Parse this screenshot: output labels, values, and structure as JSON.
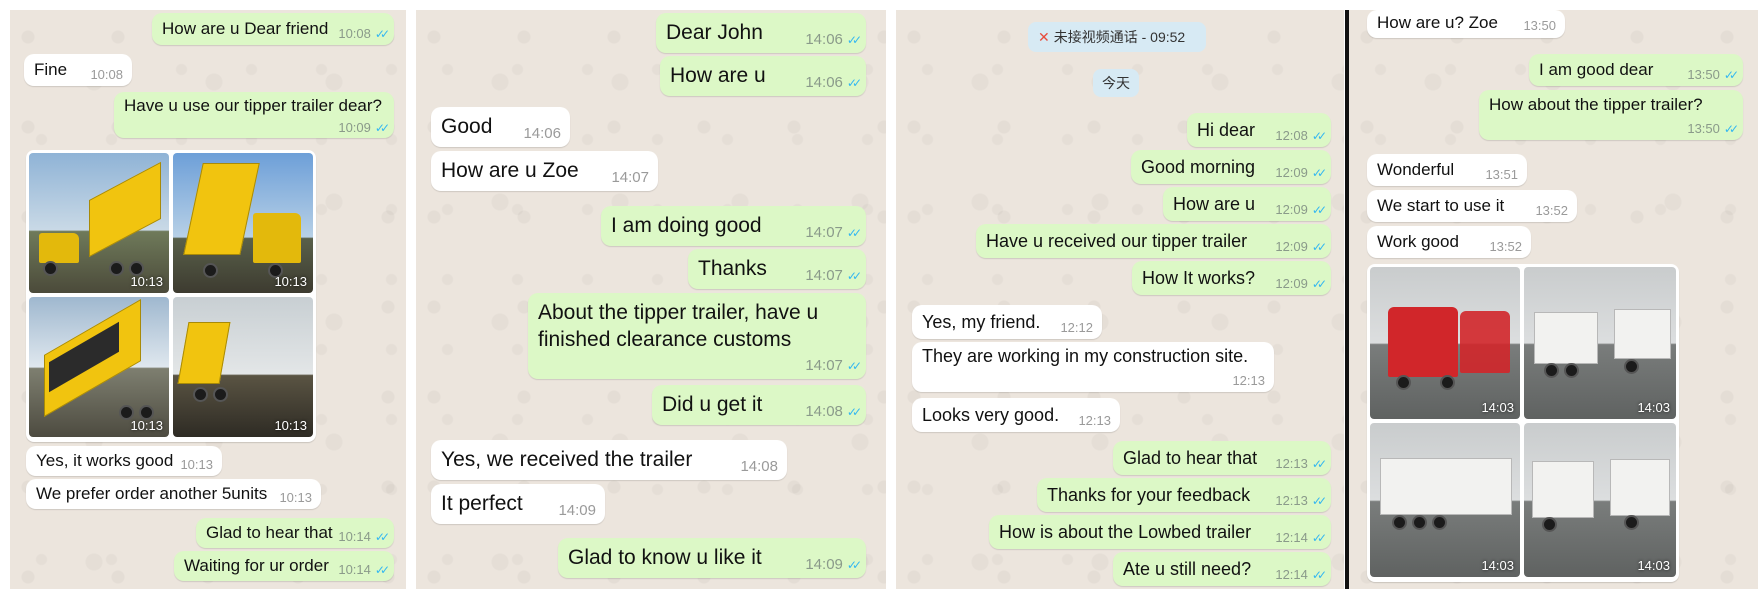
{
  "panel1": {
    "messages": [
      {
        "text": "How are u Dear friend",
        "time": "10:08",
        "dir": "out"
      },
      {
        "text": "Fine",
        "time": "10:08",
        "dir": "in"
      },
      {
        "text": "Have u use our tipper trailer dear?",
        "time": "10:09",
        "dir": "out"
      },
      {
        "text": "Yes, it works good",
        "time": "10:13",
        "dir": "in"
      },
      {
        "text": "We prefer order another 5units",
        "time": "10:13",
        "dir": "in"
      },
      {
        "text": "Glad to hear that",
        "time": "10:14",
        "dir": "out"
      },
      {
        "text": "Waiting for ur order",
        "time": "10:14",
        "dir": "out"
      }
    ],
    "photos": [
      "10:13",
      "10:13",
      "10:13",
      "10:13"
    ]
  },
  "panel2": {
    "messages": [
      {
        "text": "Dear John",
        "time": "14:06",
        "dir": "out"
      },
      {
        "text": "How are u",
        "time": "14:06",
        "dir": "out"
      },
      {
        "text": "Good",
        "time": "14:06",
        "dir": "in"
      },
      {
        "text": "How are u Zoe",
        "time": "14:07",
        "dir": "in"
      },
      {
        "text": "I am doing good",
        "time": "14:07",
        "dir": "out"
      },
      {
        "text": "Thanks",
        "time": "14:07",
        "dir": "out"
      },
      {
        "text": "About the tipper trailer, have u",
        "text2": "finished clearance customs",
        "time": "14:07",
        "dir": "out"
      },
      {
        "text": "Did u get it",
        "time": "14:08",
        "dir": "out"
      },
      {
        "text": "Yes, we received the trailer",
        "time": "14:08",
        "dir": "in"
      },
      {
        "text": "It perfect",
        "time": "14:09",
        "dir": "in"
      },
      {
        "text": "Glad to know u like it",
        "time": "14:09",
        "dir": "out"
      }
    ]
  },
  "panel3": {
    "missed_call": "未接视频通话 - 09:52",
    "date_divider": "今天",
    "messages": [
      {
        "text": "Hi dear",
        "time": "12:08",
        "dir": "out"
      },
      {
        "text": "Good morning",
        "time": "12:09",
        "dir": "out"
      },
      {
        "text": "How are u",
        "time": "12:09",
        "dir": "out"
      },
      {
        "text": "Have u received our tipper trailer",
        "time": "12:09",
        "dir": "out"
      },
      {
        "text": "How It works?",
        "time": "12:09",
        "dir": "out"
      },
      {
        "text": "Yes, my friend.",
        "time": "12:12",
        "dir": "in"
      },
      {
        "text": "They are working in my construction site.",
        "time": "12:13",
        "dir": "in"
      },
      {
        "text": "Looks very good.",
        "time": "12:13",
        "dir": "in"
      },
      {
        "text": "Glad to hear that",
        "time": "12:13",
        "dir": "out"
      },
      {
        "text": "Thanks for your feedback",
        "time": "12:13",
        "dir": "out"
      },
      {
        "text": "How is about the Lowbed trailer",
        "time": "12:14",
        "dir": "out"
      },
      {
        "text": "Ate u still need?",
        "time": "12:14",
        "dir": "out"
      }
    ]
  },
  "panel4": {
    "messages": [
      {
        "text": "How are u? Zoe",
        "time": "13:50",
        "dir": "in"
      },
      {
        "text": "I am good dear",
        "time": "13:50",
        "dir": "out"
      },
      {
        "text": "How about the tipper trailer?",
        "time": "13:50",
        "dir": "out"
      },
      {
        "text": "Wonderful",
        "time": "13:51",
        "dir": "in"
      },
      {
        "text": "We start to use it",
        "time": "13:52",
        "dir": "in"
      },
      {
        "text": "Work good",
        "time": "13:52",
        "dir": "in"
      }
    ],
    "photos": [
      "14:03",
      "14:03",
      "14:03",
      "14:03"
    ]
  },
  "colors": {
    "outgoing": "#dcf8c6",
    "incoming": "#ffffff",
    "read_ticks": "#34b7f1",
    "wallpaper": "#ece5dd"
  },
  "icons": {
    "read_receipt": "double-check-icon",
    "missed_call": "missed-video-call-icon"
  }
}
